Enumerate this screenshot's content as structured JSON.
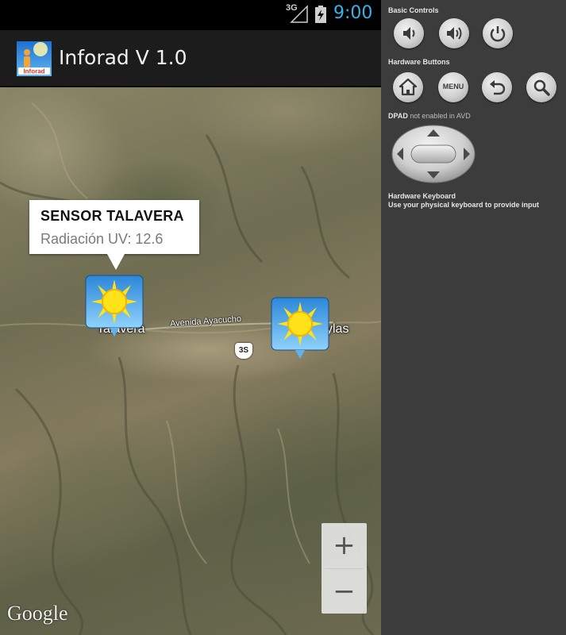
{
  "status_bar": {
    "network": "3G",
    "time": "9:00",
    "clock_color": "#33b5e5"
  },
  "action_bar": {
    "title": "Inforad V 1.0",
    "icon_text": "Inforad"
  },
  "map": {
    "info_window": {
      "title": "SENSOR TALAVERA",
      "snippet": "Radiación UV: 12.6"
    },
    "markers": [
      {
        "icon": "sun-marker-icon"
      },
      {
        "icon": "sun-marker-icon"
      }
    ],
    "labels": {
      "road": "Avenida Ayacucho",
      "place_1": "Talavera",
      "place_2": "ylas",
      "route_shield": "3S"
    },
    "zoom": {
      "in": "+",
      "out": "−"
    },
    "attribution": "Google"
  },
  "emulator": {
    "basic_controls": "Basic Controls",
    "hardware_buttons": "Hardware Buttons",
    "menu_label": "MENU",
    "dpad_label": "DPAD",
    "dpad_note": "not enabled in AVD",
    "keyboard_title": "Hardware Keyboard",
    "keyboard_hint": "Use your physical keyboard to provide input"
  }
}
